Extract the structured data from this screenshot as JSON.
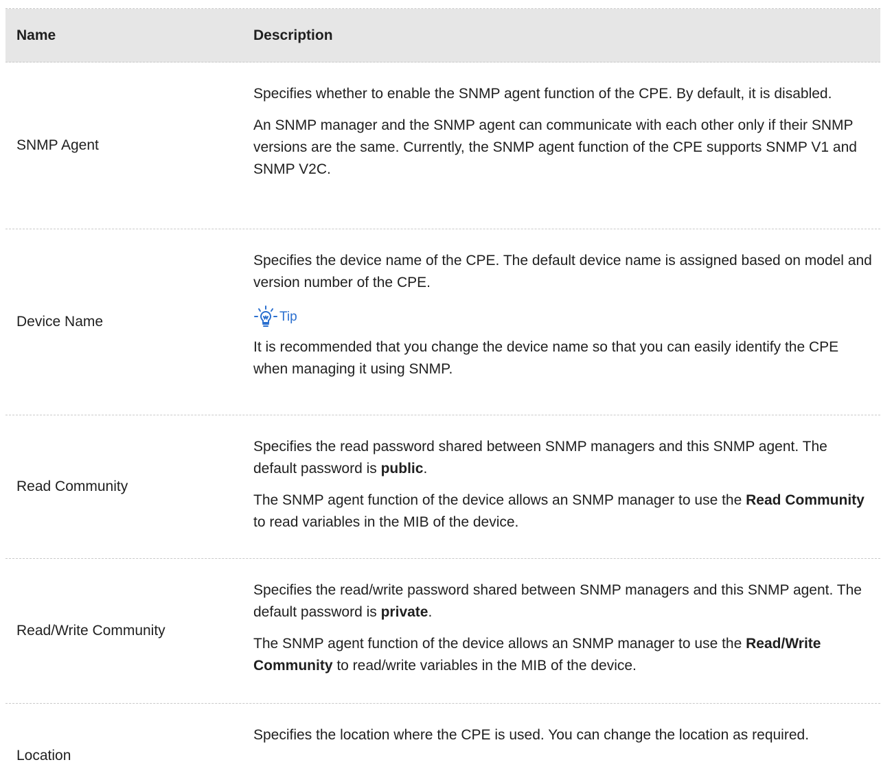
{
  "header": {
    "name": "Name",
    "description": "Description"
  },
  "rows": [
    {
      "name": "SNMP Agent",
      "p1": "Specifies whether to enable the SNMP agent function of the CPE. By default, it is disabled.",
      "p2": "An SNMP manager and the SNMP agent can communicate with each other only if their SNMP versions are the same. Currently, the SNMP agent function of the CPE supports SNMP V1 and SNMP V2C."
    },
    {
      "name": "Device Name",
      "p1": "Specifies the device name of the CPE. The default device name is assigned based on model and version number of the CPE.",
      "tip_label": "Tip",
      "tip_icon": "lightbulb-icon",
      "tip_color": "#2a6fcf",
      "p2": "It is recommended that you change the device name so that you can easily identify the CPE when managing it using SNMP."
    },
    {
      "name": "Read Community",
      "p1_pre": "Specifies the read password shared between SNMP managers and this SNMP agent. The default password is ",
      "p1_bold": "public",
      "p1_post": ".",
      "p2_pre": "The SNMP agent function of the device allows an SNMP manager to use the ",
      "p2_bold": "Read Community",
      "p2_post": " to read variables in the MIB of the device."
    },
    {
      "name": "Read/Write Community",
      "p1_pre": "Specifies the read/write password shared between SNMP managers and this SNMP agent. The default password is ",
      "p1_bold": "private",
      "p1_post": ".",
      "p2_pre": "The SNMP agent function of the device allows an SNMP manager to use the ",
      "p2_bold": "Read/Write Community",
      "p2_post": " to read/write variables in the MIB of the device."
    },
    {
      "name": "Location",
      "p1": "Specifies the location where the CPE is used. You can change the location as required."
    }
  ]
}
